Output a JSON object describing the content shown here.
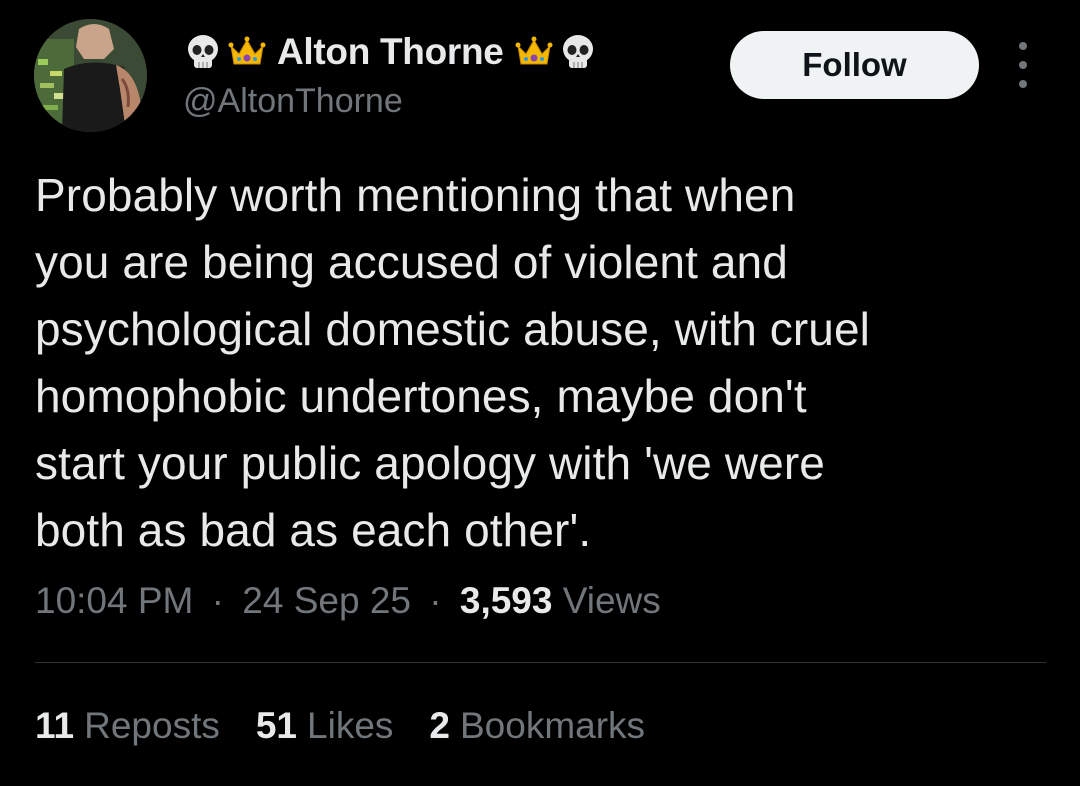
{
  "author": {
    "display_name": "Alton Thorne",
    "handle": "@AltonThorne",
    "name_emojis": [
      "skull-icon",
      "crown-icon",
      "crown-icon",
      "skull-icon"
    ]
  },
  "actions": {
    "follow_label": "Follow",
    "more_icon": "more-vertical-icon"
  },
  "tweet": {
    "text": "Probably worth mentioning that when\nyou are being accused of violent and\npsychological domestic abuse, with cruel\nhomophobic undertones, maybe don't\nstart your public apology with 'we were\nboth as bad as each other'."
  },
  "meta": {
    "time": "10:04 PM",
    "separator": "·",
    "date": "24 Sep 25",
    "views_count": "3,593",
    "views_label": "Views"
  },
  "stats": {
    "reposts_count": "11",
    "reposts_label": "Reposts",
    "likes_count": "51",
    "likes_label": "Likes",
    "bookmarks_count": "2",
    "bookmarks_label": "Bookmarks"
  },
  "colors": {
    "background": "#000000",
    "text_primary": "#e7e9ea",
    "text_secondary": "#71767b",
    "follow_button_bg": "#eff3f4",
    "divider": "#2f3336"
  }
}
